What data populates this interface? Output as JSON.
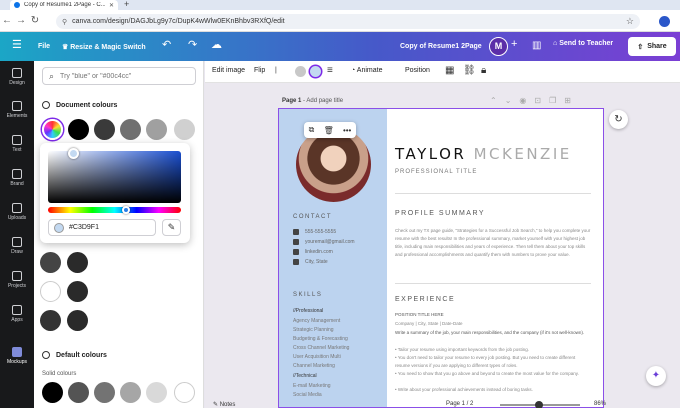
{
  "browser": {
    "tab_title": "Copy of Resume1 2Page - C...",
    "url": "canva.com/design/DAGJbLg9y7c/DupK4wWlw0EKnBhbv3RXfQ/edit"
  },
  "topbar": {
    "file": "File",
    "resize": "Resize & Magic Switch",
    "doc_title": "Copy of Resume1 2Page",
    "avatar_letter": "M",
    "send": "Send to Teacher",
    "share": "Share"
  },
  "rail": [
    "Design",
    "Elements",
    "Text",
    "Brand",
    "Uploads",
    "Draw",
    "Projects",
    "Apps",
    "Mockups"
  ],
  "panel": {
    "search_placeholder": "Try \"blue\" or \"#00c4cc\"",
    "doc_colours": "Document colours",
    "default_colours": "Default colours",
    "solid_colours": "Solid colours",
    "hex_value": "#C3D9F1"
  },
  "ctx": {
    "edit_image": "Edit image",
    "flip": "Flip",
    "animate": "Animate",
    "position": "Position"
  },
  "page": {
    "label": "Page 1",
    "add_title": "- Add page title"
  },
  "resume": {
    "first": "TAYLOR",
    "last": "MCKENZIE",
    "title": "PROFESSIONAL TITLE",
    "contact": "CONTACT",
    "contacts": [
      "555-555-5555",
      "youremail@gmail.com",
      "linkedin.com",
      "City, State"
    ],
    "skills": "SKILLS",
    "skill_items": [
      "//Professional",
      "Agency Management",
      "Strategic Planning",
      "Budgeting & Forecasting",
      "Cross Channel Marketing",
      "User Acquisition Multi",
      "Channel Marketing",
      "//Technical",
      "E-mail Marketing",
      "Social Media"
    ],
    "profile_summary": "PROFILE SUMMARY",
    "profile_text": "Check out my TX page guide, \"Strategies for a Successful Job Search,\" to help you complete your resume with the best results! In the professional summary, market yourself with your highest job title, including main responsibilities and years of experience. Then tell them about your top skills and professional accomplishments and quantify them with numbers to prove your value.",
    "experience": "EXPERIENCE",
    "pos_title": "POSITION TITLE HERE",
    "company": "Company | City, State | Date-Date",
    "exp_text": "Write a summary of the job, your main responsibilities, and the company (if it's not well-known).",
    "bullets": [
      "• Tailor your resume using important keywords from the job posting.",
      "• You don't need to tailor your resume to every job posting. But you need to create different resume versions if you are applying to different types of roles.",
      "• You need to show that you go above and beyond to create the most value for the company.",
      "• Write about your professional achievements instead of boring tasks."
    ]
  },
  "bottom": {
    "notes": "Notes",
    "pages": "Page 1 / 2",
    "zoom": "86%"
  },
  "colors": {
    "document": [
      "#000000",
      "#3a3a3a",
      "#707070",
      "#a0a0a0",
      "#d0d0d0"
    ],
    "default_row": [
      "#000000",
      "#545454",
      "#737373",
      "#a6a6a6",
      "#d9d9d9"
    ]
  }
}
